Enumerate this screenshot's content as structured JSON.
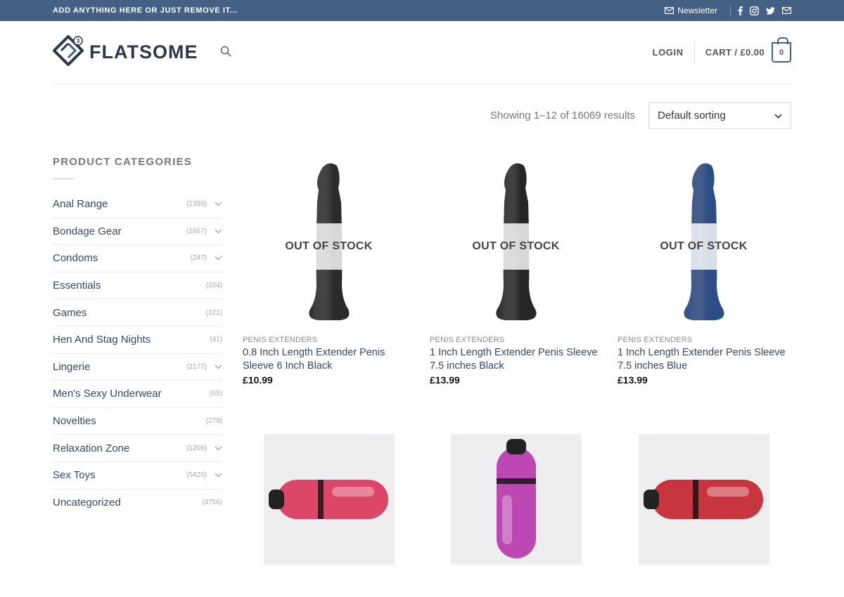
{
  "topbar": {
    "promo": "ADD ANYTHING HERE OR JUST REMOVE IT...",
    "newsletter": "Newsletter",
    "social_icons": [
      "facebook-icon",
      "instagram-icon",
      "twitter-icon",
      "envelope-icon"
    ]
  },
  "header": {
    "logo_text": "FLATSOME",
    "login": "LOGIN",
    "cart_label": "CART / £0.00",
    "cart_count": "0"
  },
  "shop": {
    "results_count": "Showing 1–12 of 16069 results",
    "sort_value": "Default sorting"
  },
  "sidebar": {
    "title": "PRODUCT CATEGORIES",
    "categories": [
      {
        "name": "Anal Range",
        "count": "(1399)"
      },
      {
        "name": "Bondage Gear",
        "count": "(1667)"
      },
      {
        "name": "Condoms",
        "count": "(247)"
      },
      {
        "name": "Essentials",
        "count": "(104)"
      },
      {
        "name": "Games",
        "count": "(121)"
      },
      {
        "name": "Hen And Stag Nights",
        "count": "(41)"
      },
      {
        "name": "Lingerie",
        "count": "(2177)"
      },
      {
        "name": "Men's Sexy Underwear",
        "count": "(65)"
      },
      {
        "name": "Novelties",
        "count": "(279)"
      },
      {
        "name": "Relaxation Zone",
        "count": "(1206)"
      },
      {
        "name": "Sex Toys",
        "count": "(5426)"
      },
      {
        "name": "Uncategorized",
        "count": "(3756)"
      }
    ]
  },
  "products": [
    {
      "category": "PENIS EXTENDERS",
      "title": "0.8 Inch Length Extender Penis Sleeve 6 Inch Black",
      "price": "£10.99",
      "badge": "OUT OF STOCK",
      "color": "#2b2b2b"
    },
    {
      "category": "PENIS EXTENDERS",
      "title": "1 Inch Length Extender Penis Sleeve 7.5 inches Black",
      "price": "£13.99",
      "badge": "OUT OF STOCK",
      "color": "#262626"
    },
    {
      "category": "PENIS EXTENDERS",
      "title": "1 Inch Length Extender Penis Sleeve 7.5 inches Blue",
      "price": "£13.99",
      "badge": "OUT OF STOCK",
      "color": "#2c4d88"
    },
    {
      "color": "#d8284f"
    },
    {
      "color": "#b52aa8"
    },
    {
      "color": "#c2141e"
    }
  ],
  "colors": {
    "primary": "#446084",
    "link": "#334862"
  }
}
